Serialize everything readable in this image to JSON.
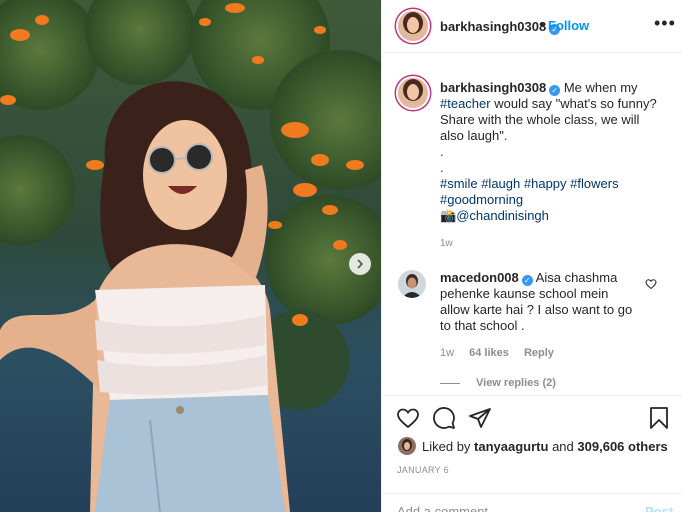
{
  "post": {
    "username": "barkhasingh0308",
    "follow_label": "Follow",
    "separator": "•",
    "more_label": "•••"
  },
  "caption": {
    "username": "barkhasingh0308",
    "text_1": "Me when my",
    "tag_teacher": "#teacher",
    "text_2": "would say \"what's so funny? Share with the whole class, we will also laugh\".",
    "dot_line": ".",
    "hashtags": [
      "#smile",
      "#laugh",
      "#happy",
      "#flowers",
      "#goodmorning"
    ],
    "camera_emoji": "📸",
    "mention": "@chandinisingh",
    "time": "1w"
  },
  "comment": {
    "username": "macedon008",
    "text": "Aisa chashma pehenke kaunse school mein allow karte hai ? I also want to go to that school .",
    "time": "1w",
    "likes": "64 likes",
    "reply_label": "Reply",
    "view_replies": "View replies (2)"
  },
  "likes": {
    "prefix": "Liked by",
    "user": "tanyaagurtu",
    "mid": "and",
    "count": "309,606 others"
  },
  "date": "JANUARY 6",
  "add_comment": {
    "placeholder": "Add a comment...",
    "post_label": "Post"
  },
  "colors": {
    "accent": "#0095f6",
    "verified": "#3897f0",
    "hashtag": "#00376b",
    "muted": "#8e8e8e",
    "flower_orange": "#f07a1e"
  },
  "icons": [
    "heart-icon",
    "comment-icon",
    "share-icon",
    "bookmark-icon",
    "more-icon",
    "chevron-right-icon",
    "verified-badge-icon"
  ]
}
